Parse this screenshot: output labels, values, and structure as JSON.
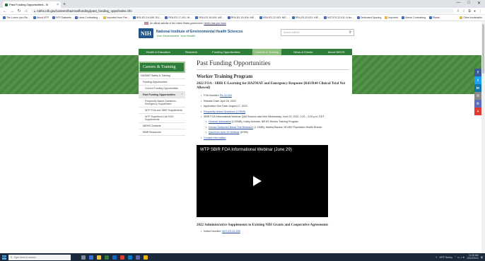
{
  "browser": {
    "tab_title": "Past Funding Opportunities - N",
    "new_tab": "+",
    "url": "niehs.nih.gov/careers/hazmat/funding/past_funding_opps/index.cfm",
    "window_controls": [
      "—",
      "□",
      "✕"
    ],
    "bookmarks": [
      {
        "label": "The Lorem Ipsu Re...",
        "folder": false
      },
      {
        "label": "About NTP",
        "folder": false
      },
      {
        "label": "NTP Datasets",
        "folder": false
      },
      {
        "label": "Linda Contracting...",
        "folder": false
      },
      {
        "label": "Imported from Fire...",
        "folder": true
      },
      {
        "label": "RFA-ES-19-008: 201...",
        "folder": false
      },
      {
        "label": "RFA-ES-17-001: NI...",
        "folder": false
      },
      {
        "label": "RFA-ES-16-009: NIE...",
        "folder": false
      },
      {
        "label": "RFA-ES-19-009: NIE...",
        "folder": false
      },
      {
        "label": "RFA-ES-22-003: NIE...",
        "folder": false
      },
      {
        "label": "RFA-ES-22-001: NIE...",
        "folder": false
      },
      {
        "label": "NOT-ES-22-011: A No...",
        "folder": false
      },
      {
        "label": "Dedicated Spacing",
        "folder": false
      },
      {
        "label": "Imported",
        "folder": true
      },
      {
        "label": "Above Contracting",
        "folder": false
      },
      {
        "label": "Plants",
        "folder": false
      }
    ],
    "bookmarks_right": "Other bookmarks"
  },
  "gov_banner": {
    "text": "An official website of the United States government",
    "link": "Here's how you know"
  },
  "header": {
    "logo": "NIH",
    "institute_name": "National Institute of Environmental Health Sciences",
    "tagline": "Your Environment. Your Health.",
    "search_placeholder": "Search NIEHS"
  },
  "nav": [
    {
      "label": "Health & Education",
      "active": false
    },
    {
      "label": "Research",
      "active": false
    },
    {
      "label": "Funding Opportunities",
      "active": false
    },
    {
      "label": "Careers & Training",
      "active": true
    },
    {
      "label": "News & Events",
      "active": false
    },
    {
      "label": "About NIEHS",
      "active": false
    }
  ],
  "sidebar": {
    "title": "Careers & Training",
    "items": [
      {
        "label": "HAZMAT Safety & Training",
        "level": 1
      },
      {
        "label": "Funding Opportunities",
        "level": 2
      },
      {
        "label": "Current Funding Opportunities",
        "level": 3
      },
      {
        "label": "Past Funding Opportunities",
        "level": 2,
        "active": true
      },
      {
        "label": "Frequently Asked Questions - Emergency Supplement",
        "level": 3
      },
      {
        "label": "WTP FOA and SBIR Supplements",
        "level": 3
      },
      {
        "label": "WTP Superfund Lab 2019 Supplements",
        "level": 3
      },
      {
        "label": "NIEHS Contacts",
        "level": 2
      },
      {
        "label": "SBIR Resources",
        "level": 2
      }
    ]
  },
  "article": {
    "title": "Past Funding Opportunities",
    "section_title": "Worker Training Program",
    "foa_title": "2022 FOA - SBIR E-Learning for HAZMAT and Emergency Response (R43/R44 Clinical Trial Not Allowed)",
    "bullets": [
      {
        "prefix": "FOA Number: ",
        "link": "PA-22-204"
      },
      {
        "prefix": "Release Date: April 26, 2022",
        "link": ""
      },
      {
        "prefix": "Application Due Date: August 17, 2022",
        "link": ""
      },
      {
        "prefix": "",
        "link": "Frequently Asked Questions (175KB)"
      },
      {
        "prefix": "SBIR FOA Informational Webinar Q&A Session was held Wednesday, June 29, 2022, 1:00 – 3:00 p.m. EDT",
        "link": ""
      }
    ],
    "sub_bullets": [
      {
        "link": "General Information",
        "suffix": " (1.92MB), Kathy Ahlmark, NIEHS Worker Training Program"
      },
      {
        "link": "Human Subjects/Clinical Trial Research",
        "suffix": " (1.72MB), Martha Barnes, NCI/NS Population Health Branch"
      },
      {
        "link": "Q&A from June 29 Webinar",
        "suffix": " (87KB)"
      }
    ],
    "contact": "Contact Information",
    "video_title": "WTP SBIR FOA Informational Webinar (June 29)",
    "supp_title": "2022 Administrative Supplements to Existing NIH Grants and Cooperative Agreements",
    "supp_bullet_prefix": "Notice Number: ",
    "supp_bullet_link": "NOT-ES-22-005"
  },
  "social": [
    {
      "label": "f",
      "color": "#3b5998"
    },
    {
      "label": "t",
      "color": "#1da1f2"
    },
    {
      "label": "in",
      "color": "#0e76a8"
    },
    {
      "label": "✉",
      "color": "#888888"
    },
    {
      "label": "⚙",
      "color": "#5c6bc0"
    },
    {
      "label": "+",
      "color": "#e53935"
    }
  ],
  "taskbar": {
    "search_placeholder": "Type here to search",
    "weather": "69°F Sunny",
    "time": "11:08 AM",
    "date": "10/12/2022"
  }
}
